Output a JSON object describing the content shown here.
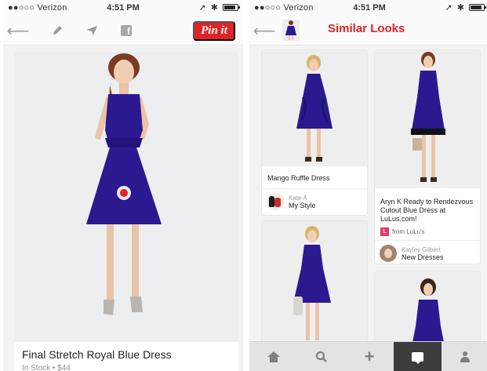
{
  "left_screen": {
    "status": {
      "carrier": "●●○○○ Verizon",
      "time": "4:51 PM"
    },
    "toolbar": {
      "pin_label": "Pin it",
      "facebook_glyph": "f"
    },
    "pin": {
      "title": "Final Stretch Royal Blue Dress",
      "subtitle": "In Stock • $44"
    }
  },
  "right_screen": {
    "status": {
      "carrier": "●●○○○ Verizon",
      "time": "4:51 PM"
    },
    "header": {
      "title": "Similar Looks"
    },
    "cards": [
      {
        "caption": "Mango Ruffle Dress",
        "user": "Kate A",
        "board": "My Style"
      },
      {
        "caption": "Aryn K Ready to Rendezvous Cutout Blue Dress at LuLus.com!",
        "source": "from LuLu's",
        "user": "Kayley Gilbert",
        "board": "New Dresses"
      },
      {
        "caption": ""
      },
      {
        "caption": ""
      }
    ],
    "tabs": [
      "home-icon",
      "search-icon",
      "add-icon",
      "news-icon",
      "profile-icon"
    ]
  },
  "colors": {
    "brand_red": "#e12227",
    "dress_blue": "#2b1a8f",
    "tab_active": "#3c3c3c"
  }
}
